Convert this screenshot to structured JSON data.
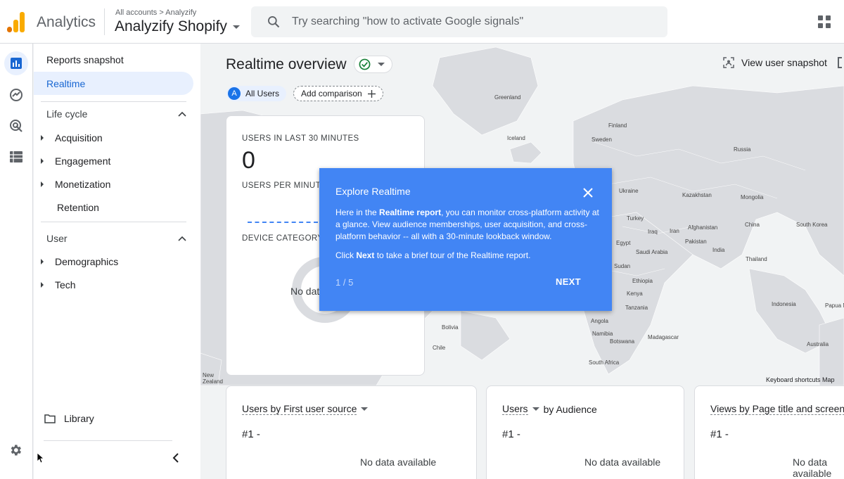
{
  "header": {
    "app_name": "Analytics",
    "breadcrumb": "All accounts > Analyzify",
    "property_name": "Analyzify Shopify",
    "search_placeholder": "Try searching \"how to activate Google signals\""
  },
  "colors": {
    "accent_blue": "#1a73e8",
    "popup_blue": "#4285f4",
    "logo_orange": "#f9ab00",
    "logo_dark_orange": "#e37400"
  },
  "nav": {
    "reports_snapshot": "Reports snapshot",
    "realtime": "Realtime",
    "lifecycle": {
      "label": "Life cycle",
      "items": [
        "Acquisition",
        "Engagement",
        "Monetization",
        "Retention"
      ]
    },
    "user": {
      "label": "User",
      "items": [
        "Demographics",
        "Tech"
      ]
    },
    "library": "Library"
  },
  "main": {
    "title": "Realtime overview",
    "chip_all_users": "All Users",
    "chip_avatar_letter": "A",
    "add_comparison": "Add comparison",
    "view_user_snapshot": "View user snapshot",
    "users_card": {
      "label": "USERS IN LAST 30 MINUTES",
      "value": "0",
      "per_minute_label": "USERS PER MINUTE",
      "device_label": "DEVICE CATEGORY I",
      "no_data": "No data"
    },
    "bottom_cards": [
      {
        "title_a": "Users by First user source",
        "title_b": "",
        "rank": "#1  -",
        "no_data": "No data available"
      },
      {
        "title_a": "Users",
        "title_b": "by Audience",
        "rank": "#1  -",
        "no_data": "No data available"
      },
      {
        "title_a": "Views by Page title and screen",
        "title_b": "",
        "rank": "#1  -",
        "no_data": "No data available"
      }
    ],
    "keyboard_shortcuts": "Keyboard shortcuts   Map",
    "map_labels": {
      "greenland": "Greenland",
      "iceland": "Iceland",
      "finland": "Finland",
      "sweden": "Sweden",
      "russia": "Russia",
      "ukraine": "Ukraine",
      "kazakhstan": "Kazakhstan",
      "mongolia": "Mongolia",
      "turkey": "Turkey",
      "china": "China",
      "south_korea": "South Korea",
      "iraq": "Iraq",
      "iran": "Iran",
      "afghanistan": "Afghanistan",
      "pakistan": "Pakistan",
      "egypt": "Egypt",
      "saudi_arabia": "Saudi Arabia",
      "india": "India",
      "thailand": "Thailand",
      "sudan": "Sudan",
      "ethiopia": "Ethiopia",
      "kenya": "Kenya",
      "tanzania": "Tanzania",
      "indonesia": "Indonesia",
      "angola": "Angola",
      "bolivia": "Bolivia",
      "namibia": "Namibia",
      "botswana": "Botswana",
      "madagascar": "Madagascar",
      "chile": "Chile",
      "south_africa": "South Africa",
      "australia": "Australia",
      "new_zealand": "New\nZealand",
      "papua": "Papua N"
    }
  },
  "popup": {
    "title": "Explore Realtime",
    "body_1": "Here in the ",
    "body_bold": "Realtime report",
    "body_2": ", you can monitor cross-platform activity at a glance. View audience memberships, user acquisition, and cross-platform behavior -- all with a 30-minute lookback window.",
    "click_1": "Click ",
    "click_bold": "Next",
    "click_2": " to take a brief tour of the Realtime report.",
    "step": "1 / 5",
    "next": "NEXT"
  }
}
